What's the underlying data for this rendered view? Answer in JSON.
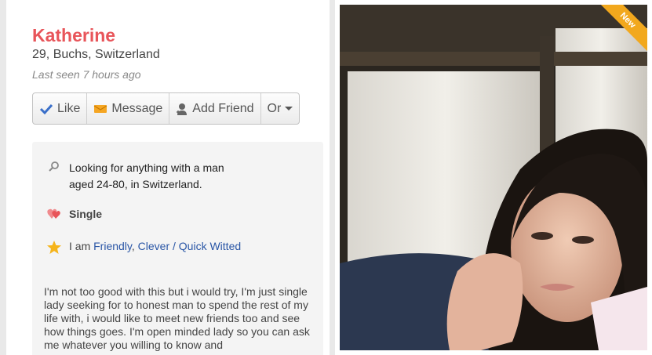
{
  "profile": {
    "name": "Katherine",
    "location": "29, Buchs, Switzerland",
    "last_seen": "Last seen 7 hours ago"
  },
  "actions": {
    "like": "Like",
    "message": "Message",
    "add_friend": "Add Friend",
    "or": "Or"
  },
  "details": {
    "looking_for": "Looking for anything with a man aged 24-80, in Switzerland.",
    "status": "Single",
    "traits_prefix": "I am",
    "trait_1": "Friendly",
    "trait_sep": ",",
    "trait_2": "Clever / Quick Witted",
    "bio": "I'm not too good with this but i would try, I'm just single lady seeking for to honest man to spend the rest of my life with, i would like to meet new friends too and see how things goes. I'm open minded lady so you can ask me whatever you willing to know and"
  },
  "photo": {
    "badge": "New"
  },
  "colors": {
    "name": "#e8555a",
    "link": "#2a56a6",
    "badge": "#f2a81d",
    "like_check": "#3a6fc9",
    "heart": "#e8555a",
    "star": "#f5b41b"
  },
  "icons": {
    "like": "checkmark-icon",
    "message": "envelope-icon",
    "add_friend": "add-person-icon",
    "or": "caret-down-icon",
    "looking": "search-icon",
    "status": "hearts-icon",
    "traits": "star-icon"
  }
}
